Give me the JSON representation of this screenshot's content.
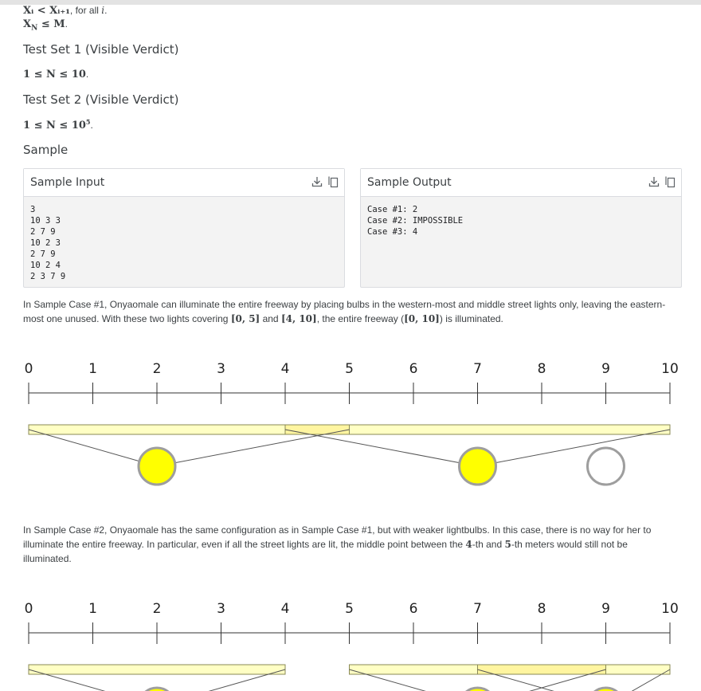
{
  "constraints": {
    "c1_math": "Xᵢ < Xᵢ₊₁",
    "c1_text": ", for all ",
    "c1_var": "i",
    "c1_end": ".",
    "c2_math": "X",
    "c2_sub": "N",
    "c2_rest": " ≤ M",
    "c2_end": "."
  },
  "test_set_1": {
    "heading": "Test Set 1 (Visible Verdict)",
    "constraint": "1 ≤ N ≤ 10",
    "end": "."
  },
  "test_set_2": {
    "heading": "Test Set 2 (Visible Verdict)",
    "constraint": "1 ≤ N ≤ 10",
    "sup": "5",
    "end": "."
  },
  "sample": {
    "heading": "Sample",
    "input_title": "Sample Input",
    "input_text": "3\n10 3 3\n2 7 9\n10 2 3\n2 7 9\n10 2 4\n2 3 7 9",
    "output_title": "Sample Output",
    "output_text": "Case #1: 2\nCase #2: IMPOSSIBLE\nCase #3: 4",
    "icons": [
      "download-icon",
      "copy-icon"
    ]
  },
  "explanation_1": {
    "t1": "In Sample Case #1, Onyaomale can illuminate the entire freeway by placing bulbs in the western-most and middle street lights only, leaving the eastern-most one unused. With these two lights covering ",
    "m1": "[0, 5]",
    "t2": " and ",
    "m2": "[4, 10]",
    "t3": ", the entire freeway (",
    "m3": "[0, 10]",
    "t4": ") is illuminated."
  },
  "explanation_2": {
    "t1": "In Sample Case #2, Onyaomale has the same configuration as in Sample Case #1, but with weaker lightbulbs. In this case, there is no way for her to illuminate the entire freeway. In particular, even if all the street lights are lit, the middle point between the ",
    "m1": "4",
    "t2": "-th and ",
    "m2": "5",
    "t3": "-th meters would still not be illuminated."
  },
  "diagram_1": {
    "ticks": [
      "0",
      "1",
      "2",
      "3",
      "4",
      "5",
      "6",
      "7",
      "8",
      "9",
      "10"
    ],
    "lights": [
      {
        "position": 2,
        "lit": true,
        "range": [
          0,
          5
        ]
      },
      {
        "position": 7,
        "lit": true,
        "range": [
          4,
          10
        ]
      },
      {
        "position": 9,
        "lit": false
      }
    ]
  },
  "diagram_2": {
    "ticks": [
      "0",
      "1",
      "2",
      "3",
      "4",
      "5",
      "6",
      "7",
      "8",
      "9",
      "10"
    ],
    "lights": [
      {
        "position": 2,
        "lit": true,
        "range": [
          0,
          4
        ]
      },
      {
        "position": 7,
        "lit": true,
        "range": [
          5,
          9
        ]
      },
      {
        "position": 9,
        "lit": true,
        "range": [
          7,
          10
        ]
      }
    ]
  },
  "colors": {
    "bulb_on": "#ffff00",
    "bulb_off": "#ffffff",
    "bulb_stroke": "#9e9e9e",
    "range_fill": "#ffffc4",
    "overlap_fill": "#fff5a0",
    "range_stroke": "#8a8a55"
  }
}
